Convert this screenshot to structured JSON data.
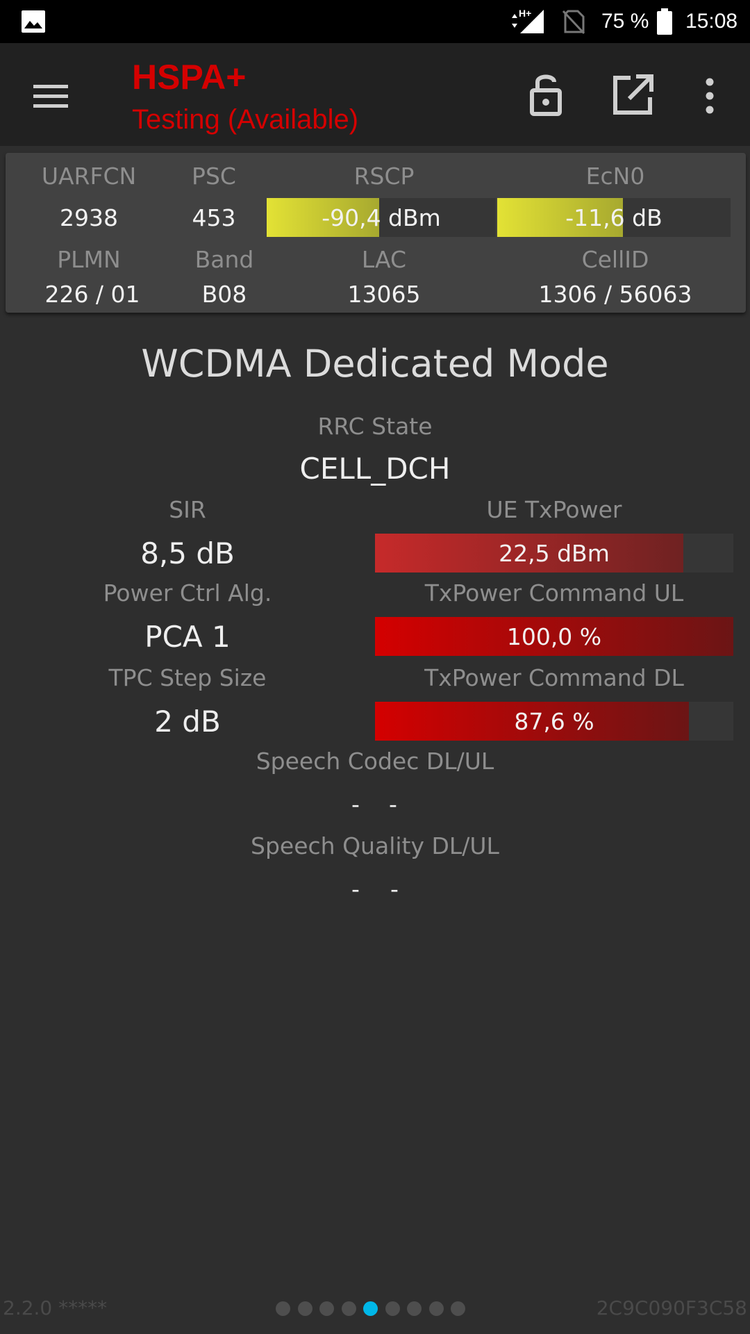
{
  "status_bar": {
    "battery_percent": "75 %",
    "time": "15:08",
    "icons": [
      "gallery-icon",
      "data-activity-icon",
      "cellular-signal-icon",
      "no-sim-icon",
      "battery-icon"
    ]
  },
  "app_bar": {
    "title": "HSPA+",
    "subtitle": "Testing (Available)",
    "icons": [
      "menu-icon",
      "lock-open-icon",
      "open-external-icon",
      "more-vert-icon"
    ],
    "accent_color": "#d50000"
  },
  "cell_info": {
    "uarfcn": {
      "label": "UARFCN",
      "value": "2938"
    },
    "psc": {
      "label": "PSC",
      "value": "453"
    },
    "rscp": {
      "label": "RSCP",
      "value": "-90,4 dBm",
      "fill_fraction": 0.49,
      "color": "#e3e235"
    },
    "ecn0": {
      "label": "EcN0",
      "value": "-11,6 dB",
      "fill_fraction": 0.54,
      "color": "#e3e235"
    },
    "plmn": {
      "label": "PLMN",
      "value": "226 / 01"
    },
    "band": {
      "label": "Band",
      "value": "B08"
    },
    "lac": {
      "label": "LAC",
      "value": "13065"
    },
    "cellid": {
      "label": "CellID",
      "value": "1306 / 56063"
    }
  },
  "mode": {
    "title": "WCDMA Dedicated Mode",
    "rrc_state": {
      "label": "RRC State",
      "value": "CELL_DCH"
    },
    "sir": {
      "label": "SIR",
      "value": "8,5 dB"
    },
    "ue_txpower": {
      "label": "UE TxPower",
      "value": "22,5 dBm",
      "fill_fraction": 0.86
    },
    "power_ctrl_alg": {
      "label": "Power Ctrl Alg.",
      "value": "PCA 1"
    },
    "txpower_cmd_ul": {
      "label": "TxPower Command UL",
      "value": "100,0 %",
      "fill_fraction": 1.0
    },
    "tpc_step_size": {
      "label": "TPC Step Size",
      "value": "2 dB"
    },
    "txpower_cmd_dl": {
      "label": "TxPower Command DL",
      "value": "87,6 %",
      "fill_fraction": 0.876
    },
    "speech_codec": {
      "label": "Speech Codec DL/UL",
      "dl": "-",
      "ul": "-"
    },
    "speech_quality": {
      "label": "Speech Quality DL/UL",
      "dl": "-",
      "ul": "-"
    }
  },
  "footer": {
    "version": "2.2.0 *****",
    "device_id": "2C9C090F3C58",
    "pager": {
      "total": 9,
      "active_index": 4,
      "active_color": "#00b7e8"
    }
  }
}
